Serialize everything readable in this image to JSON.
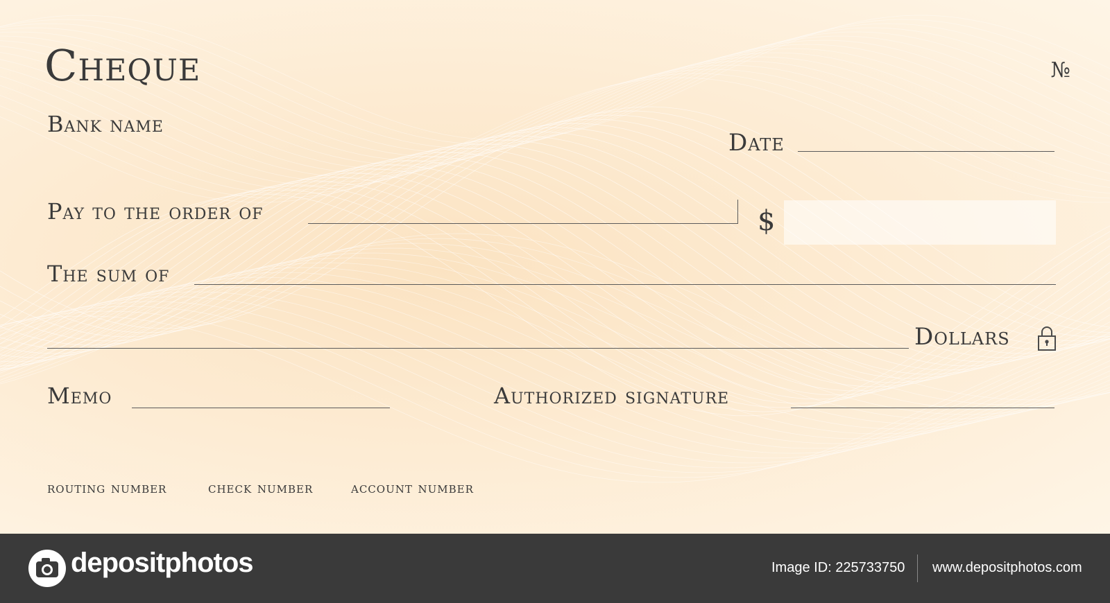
{
  "cheque": {
    "title": "Cheque",
    "number_sign": "№",
    "bank_name": "Bank name",
    "date_label": "Date",
    "pay_label": "Pay to the order of",
    "currency_symbol": "$",
    "sum_label": "The sum of",
    "dollars_label": "Dollars",
    "memo_label": "Memo",
    "signature_label": "Authorized signature",
    "routing_label": "routing number",
    "check_number_label": "check number",
    "account_label": "account number",
    "icons": {
      "lock": "lock-icon"
    },
    "colors": {
      "paper": "#fdebd2",
      "ink": "#3a3a3a",
      "pattern": "#ffffff"
    }
  },
  "footer": {
    "brand": "depositphotos",
    "image_id": "Image ID: 225733750",
    "url": "www.depositphotos.com",
    "icons": {
      "logo": "camera-logo-icon"
    },
    "colors": {
      "background": "#3a3a3a",
      "text": "#ffffff"
    }
  }
}
